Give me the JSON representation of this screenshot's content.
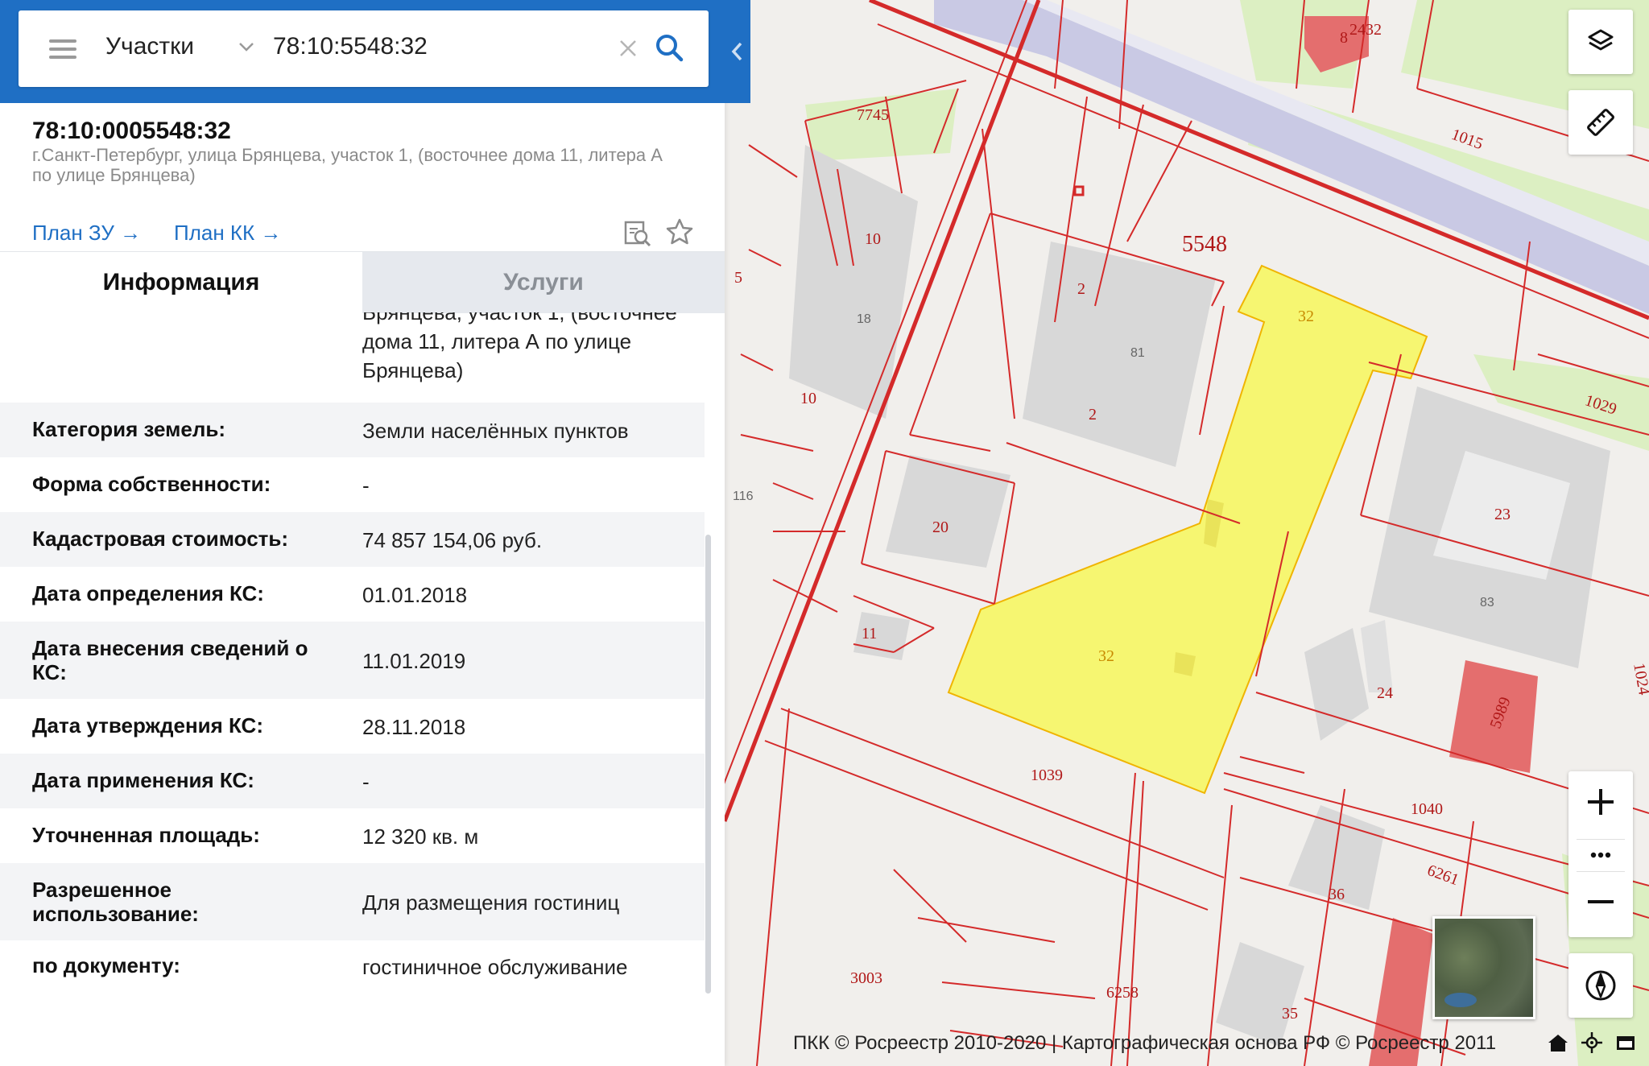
{
  "search": {
    "category": "Участки",
    "query": "78:10:5548:32",
    "menu_icon": "hamburger-icon",
    "clear_icon": "close-icon",
    "search_icon": "search-icon"
  },
  "card": {
    "cad_number": "78:10:0005548:32",
    "address": "г.Санкт-Петербург, улица Брянцева, участок 1, (восточнее дома 11, литера А по улице Брянцева)",
    "link_zu": "План ЗУ →",
    "link_kk": "План КК →"
  },
  "tabs": {
    "info": "Информация",
    "services": "Услуги"
  },
  "info": {
    "address_continued": "Брянцева, участок 1, (восточнее дома 11, литера А по улице Брянцева)",
    "rows": [
      {
        "key": "Категория земель:",
        "value": "Земли населённых пунктов"
      },
      {
        "key": "Форма собственности:",
        "value": "-"
      },
      {
        "key": "Кадастровая стоимость:",
        "value": "74 857 154,06 руб."
      },
      {
        "key": "Дата определения КС:",
        "value": "01.01.2018"
      },
      {
        "key": "Дата внесения сведений о КС:",
        "value": "11.01.2019"
      },
      {
        "key": "Дата утверждения КС:",
        "value": "28.11.2018"
      },
      {
        "key": "Дата применения КС:",
        "value": "-"
      },
      {
        "key": "Уточненная площадь:",
        "value": "12 320 кв. м"
      },
      {
        "key": "Разрешенное использование:",
        "value": "Для размещения гостиниц"
      },
      {
        "key": "по документу:",
        "value": "гостиничное обслуживание"
      }
    ]
  },
  "map": {
    "labels": {
      "l7745": "7745",
      "l8": "8",
      "l2432": "2432",
      "l1015": "1015",
      "l5548": "5548",
      "l10a": "10",
      "l5": "5",
      "l18": "18",
      "l2a": "2",
      "l81": "81",
      "l2b": "2",
      "l32a": "32",
      "l10b": "10",
      "l1029": "1029",
      "l116": "116",
      "l20": "20",
      "l23": "23",
      "l83": "83",
      "l32b": "32",
      "l11": "11",
      "l24": "24",
      "l5989": "5989",
      "l1039": "1039",
      "l1040": "1040",
      "l6261": "6261",
      "l36": "36",
      "l3003": "3003",
      "l6258": "6258",
      "l35": "35",
      "l1024": "1024"
    },
    "colors": {
      "parcel_line": "#d42a2a",
      "selected_fill": "#f5f56a",
      "selected_stroke": "#f0b400",
      "green_zone": "#dcefc2",
      "building": "#d8d8d8",
      "building_red": "#e46e6e",
      "rail": "#c9c9e4"
    },
    "controls": {
      "layers_icon": "layers-icon",
      "ruler_icon": "ruler-icon",
      "zoom_in_icon": "plus-icon",
      "more_icon": "more-icon",
      "zoom_out_icon": "minus-icon",
      "compass_icon": "compass-icon"
    },
    "attribution": "ПКК © Росреестр 2010-2020 | Картографическая основа РФ © Росреестр 2011",
    "bottom_icons": [
      "home-icon",
      "locate-icon",
      "window-icon"
    ]
  }
}
